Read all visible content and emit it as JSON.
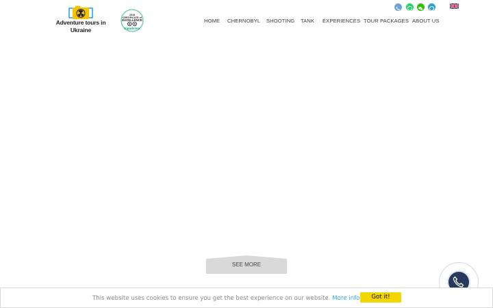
{
  "brand": {
    "name": "Adventure tours in Ukraine"
  },
  "award": {
    "line1": "2018",
    "line2": "CERTIFICATE of",
    "line3": "EXCELLENCE",
    "brand": "tripadvisor"
  },
  "contact_icons": [
    {
      "name": "phone-icon",
      "color": "#6ea3d4"
    },
    {
      "name": "whatsapp-icon",
      "color": "#25d366"
    },
    {
      "name": "wechat-icon",
      "color": "#2dc100"
    },
    {
      "name": "telegram-icon",
      "color": "#2a9fd8"
    }
  ],
  "language": "english-flag-icon",
  "nav": {
    "items": [
      "HOME",
      "CHERNOBYL",
      "SHOOTING",
      "TANK",
      "EXPERIENCES",
      "TOUR PACKAGES",
      "ABOUT US"
    ]
  },
  "hero": {
    "see_more": "SEE MORE"
  },
  "cookie": {
    "message": "This website uses cookies to ensure you get the best experience on our website.",
    "link": "More info",
    "button": "Got it!"
  },
  "colors": {
    "cookie_button": "#f1d600",
    "cookie_link": "#31a8f0",
    "phone_button": "#27395a",
    "see_more_bg": "#d9d9d9"
  }
}
